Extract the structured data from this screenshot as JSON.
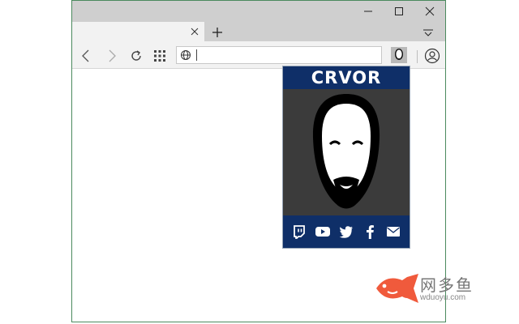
{
  "window": {
    "minimize_icon": "minimize-icon",
    "maximize_icon": "maximize-icon",
    "close_icon": "close-icon"
  },
  "tabs": {
    "active_tab_label": "",
    "new_tab_icon": "plus-icon",
    "tab_list_icon": "tab-list-icon"
  },
  "toolbar": {
    "address_value": "",
    "address_placeholder": ""
  },
  "extension_popup": {
    "title": "CRVOR",
    "social_links": [
      "twitch",
      "youtube",
      "twitter",
      "facebook",
      "email"
    ]
  },
  "watermark": {
    "brand": "网多鱼",
    "url": "wduoyu.com"
  },
  "colors": {
    "chrome_gray": "#cfcfcf",
    "popup_navy": "#0f2f68",
    "popup_bg": "#3b3b3b",
    "watermark_fish": "#f05a3c"
  }
}
